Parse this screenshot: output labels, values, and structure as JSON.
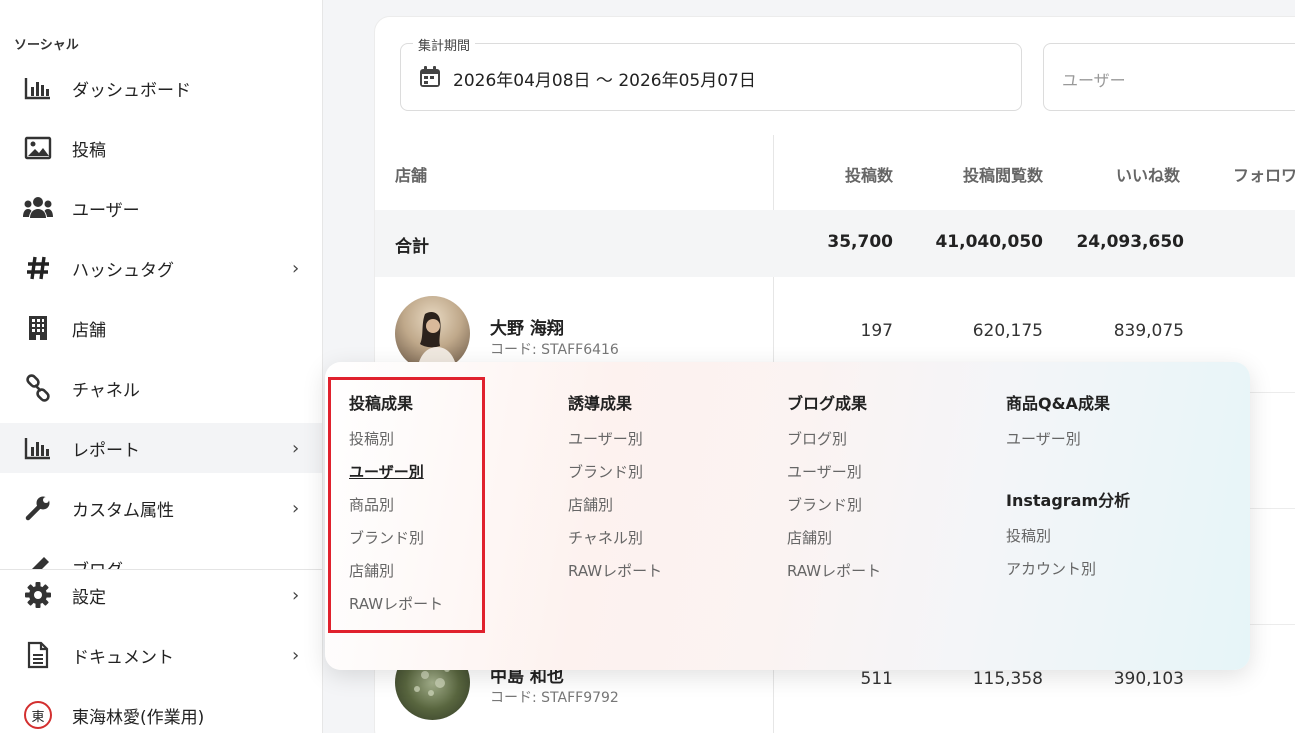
{
  "sidebar": {
    "section_label": "ソーシャル",
    "items": [
      {
        "label": "ダッシュボード",
        "icon": "bar-chart-icon",
        "chevron": false
      },
      {
        "label": "投稿",
        "icon": "image-icon",
        "chevron": false
      },
      {
        "label": "ユーザー",
        "icon": "users-icon",
        "chevron": false
      },
      {
        "label": "ハッシュタグ",
        "icon": "hashtag-icon",
        "chevron": true
      },
      {
        "label": "店舗",
        "icon": "building-icon",
        "chevron": false
      },
      {
        "label": "チャネル",
        "icon": "link-icon",
        "chevron": false
      },
      {
        "label": "レポート",
        "icon": "bar-chart-icon",
        "chevron": true,
        "active": true
      },
      {
        "label": "カスタム属性",
        "icon": "wrench-icon",
        "chevron": true
      },
      {
        "label": "ブログ",
        "icon": "pencil-icon",
        "chevron": false
      }
    ],
    "bottom": [
      {
        "label": "設定",
        "icon": "gear-icon",
        "chevron": true
      },
      {
        "label": "ドキュメント",
        "icon": "document-icon",
        "chevron": true
      },
      {
        "label": "東海林愛(作業用)",
        "icon": "account-avatar",
        "avatar_char": "東"
      }
    ]
  },
  "filters": {
    "period_label": "集計期間",
    "period_value": "2026年04月08日 〜 2026年05月07日",
    "user_placeholder": "ユーザー"
  },
  "table": {
    "headers": {
      "store": "店舗",
      "posts": "投稿数",
      "views": "投稿閲覧数",
      "likes": "いいね数",
      "followers": "フォロワ"
    },
    "total": {
      "label": "合計",
      "posts": "35,700",
      "views": "41,040,050",
      "likes": "24,093,650"
    },
    "rows": [
      {
        "name": "大野 海翔",
        "code": "コード: STAFF6416",
        "posts": "197",
        "views": "620,175",
        "likes": "839,075"
      },
      {
        "name": "中島 和也",
        "code": "コード: STAFF9792",
        "posts": "511",
        "views": "115,358",
        "likes": "390,103"
      }
    ]
  },
  "mega_menu": {
    "columns": [
      {
        "heading": "投稿成果",
        "links": [
          "投稿別",
          "ユーザー別",
          "商品別",
          "ブランド別",
          "店舗別",
          "RAWレポート"
        ],
        "current": "ユーザー別"
      },
      {
        "heading": "誘導成果",
        "links": [
          "ユーザー別",
          "ブランド別",
          "店舗別",
          "チャネル別",
          "RAWレポート"
        ]
      },
      {
        "heading": "ブログ成果",
        "links": [
          "ブログ別",
          "ユーザー別",
          "ブランド別",
          "店舗別",
          "RAWレポート"
        ]
      },
      {
        "heading": "商品Q&A成果",
        "links": [
          "ユーザー別"
        ],
        "sub_heading": "Instagram分析",
        "sub_links": [
          "投稿別",
          "アカウント別"
        ]
      }
    ]
  },
  "colors": {
    "highlight": "#e0212d",
    "avatar_ring": "#d32f2f"
  }
}
